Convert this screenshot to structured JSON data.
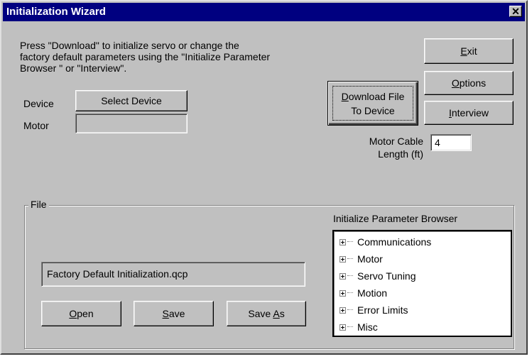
{
  "window": {
    "title": "Initialization Wizard",
    "close_glyph": "✕"
  },
  "intro": {
    "line1": "Press \"Download\" to initialize servo or change the",
    "line2": "factory default parameters using the \"Initialize Parameter",
    "line3": "Browser \" or \"Interview\"."
  },
  "device": {
    "label": "Device",
    "button": "Select Device"
  },
  "motor": {
    "label": "Motor",
    "value": ""
  },
  "buttons": {
    "exit": {
      "accel": "E",
      "rest": "xit"
    },
    "options": {
      "accel": "O",
      "rest": "ptions"
    },
    "interview": {
      "accel": "I",
      "rest": "nterview"
    },
    "download": {
      "accel": "D",
      "rest_line1": "ownload File",
      "line2": "To Device"
    }
  },
  "cable": {
    "label_line1": "Motor Cable",
    "label_line2": "Length (ft)",
    "value": "4"
  },
  "file": {
    "group_label": "File",
    "filename": "Factory Default Initialization.qcp",
    "open": {
      "accel": "O",
      "rest": "pen"
    },
    "save": {
      "accel": "S",
      "rest": "ave"
    },
    "save_as": {
      "pre": "Save ",
      "accel": "A",
      "rest": "s"
    }
  },
  "browser": {
    "label": "Initialize Parameter Browser",
    "items": [
      {
        "label": "Communications",
        "icon": "plus-expander-icon"
      },
      {
        "label": "Motor",
        "icon": "plus-expander-icon"
      },
      {
        "label": "Servo Tuning",
        "icon": "plus-expander-icon"
      },
      {
        "label": "Motion",
        "icon": "plus-expander-icon"
      },
      {
        "label": "Error Limits",
        "icon": "plus-expander-icon"
      },
      {
        "label": "Misc",
        "icon": "plus-expander-icon"
      }
    ]
  },
  "colors": {
    "titlebar": "#000080",
    "face": "#c0c0c0",
    "field": "#ffffff"
  }
}
